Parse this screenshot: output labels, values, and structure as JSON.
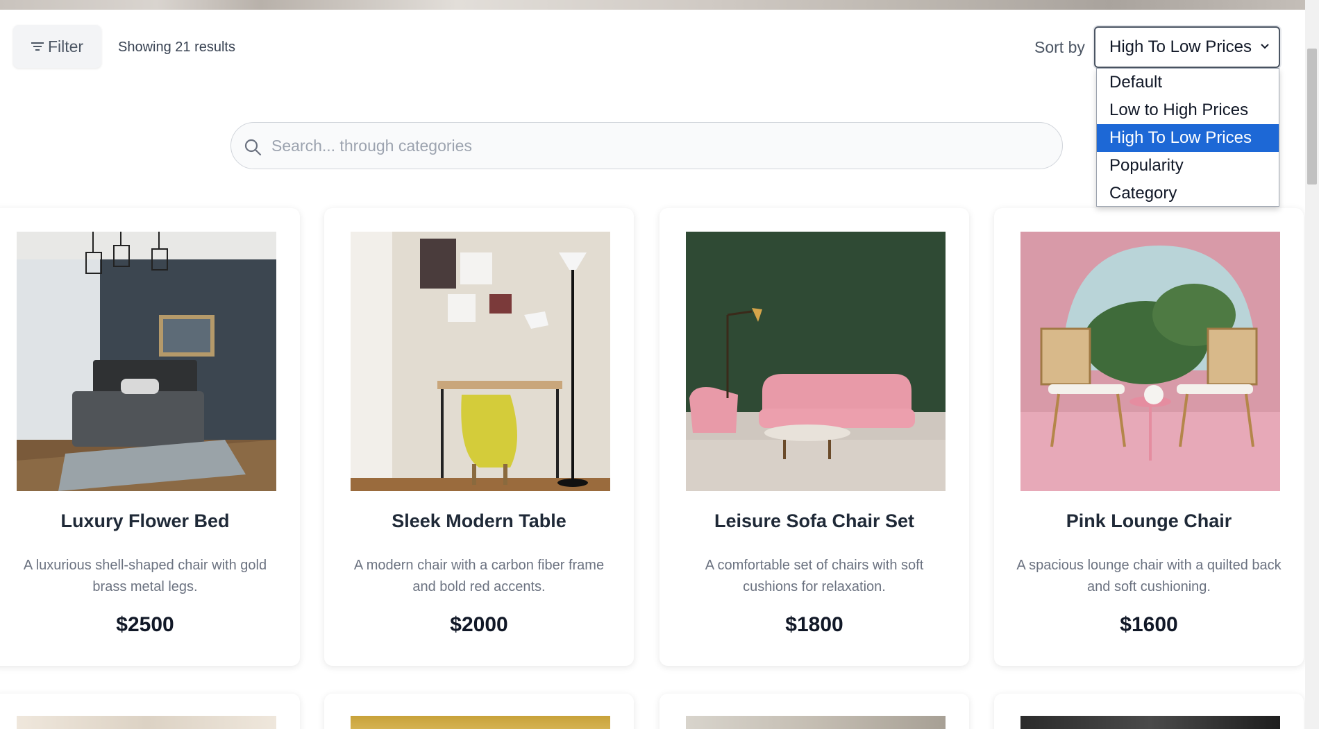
{
  "toolbar": {
    "filter_label": "Filter",
    "results_text": "Showing 21 results",
    "sort_label": "Sort by",
    "sort_selected": "High To Low Prices",
    "sort_options": [
      {
        "label": "Default",
        "selected": false
      },
      {
        "label": "Low to High Prices",
        "selected": false
      },
      {
        "label": "High To Low Prices",
        "selected": true
      },
      {
        "label": "Popularity",
        "selected": false
      },
      {
        "label": "Category",
        "selected": false
      }
    ]
  },
  "search": {
    "placeholder": "Search... through categories",
    "value": ""
  },
  "products": [
    {
      "name": "Luxury Flower Bed",
      "description": "A luxurious shell-shaped chair with gold brass metal legs.",
      "price": "$2500",
      "image": "dark bedroom with tufted bed"
    },
    {
      "name": "Sleek Modern Table",
      "description": "A modern chair with a carbon fiber frame and bold red accents.",
      "price": "$2000",
      "image": "desk with yellow chair and floor lamp"
    },
    {
      "name": "Leisure Sofa Chair Set",
      "description": "A comfortable set of chairs with soft cushions for relaxation.",
      "price": "$1800",
      "image": "pink sofa and chair on green wall"
    },
    {
      "name": "Pink Lounge Chair",
      "description": "A spacious lounge chair with a quilted back and soft cushioning.",
      "price": "$1600",
      "image": "two rattan chairs in pink arch room"
    }
  ],
  "colors": {
    "accent": "#1d68d6",
    "text": "#1f2937",
    "muted": "#6b7280",
    "card_bg": "#ffffff"
  }
}
